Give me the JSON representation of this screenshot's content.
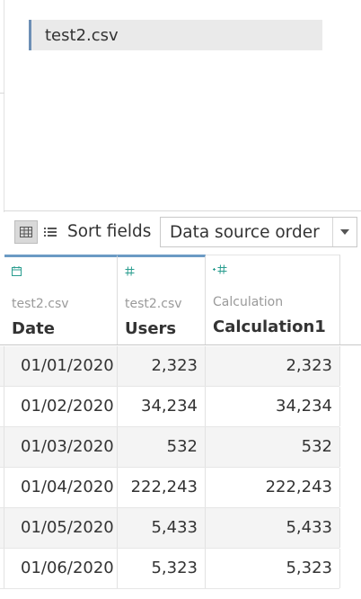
{
  "file_chip": {
    "label": "test2.csv"
  },
  "toolbar": {
    "sort_label": "Sort fields",
    "sort_select_value": "Data source order",
    "grid_view_icon": "grid-icon",
    "list_view_icon": "list-icon"
  },
  "columns": [
    {
      "icon": "calendar-icon",
      "source": "test2.csv",
      "name": "Date"
    },
    {
      "icon": "number-hash-icon",
      "source": "test2.csv",
      "name": "Users"
    },
    {
      "icon": "calculated-number-icon",
      "source": "Calculation",
      "name": "Calculation1"
    }
  ],
  "rows": [
    {
      "date": "01/01/2020",
      "users": "2,323",
      "calc": "2,323"
    },
    {
      "date": "01/02/2020",
      "users": "34,234",
      "calc": "34,234"
    },
    {
      "date": "01/03/2020",
      "users": "532",
      "calc": "532"
    },
    {
      "date": "01/04/2020",
      "users": "222,243",
      "calc": "222,243"
    },
    {
      "date": "01/05/2020",
      "users": "5,433",
      "calc": "5,433"
    },
    {
      "date": "01/06/2020",
      "users": "5,323",
      "calc": "5,323"
    }
  ],
  "colors": {
    "accent": "#6b9ac4",
    "icon_teal": "#2a9d8f",
    "stripe": "#f4f4f4"
  }
}
